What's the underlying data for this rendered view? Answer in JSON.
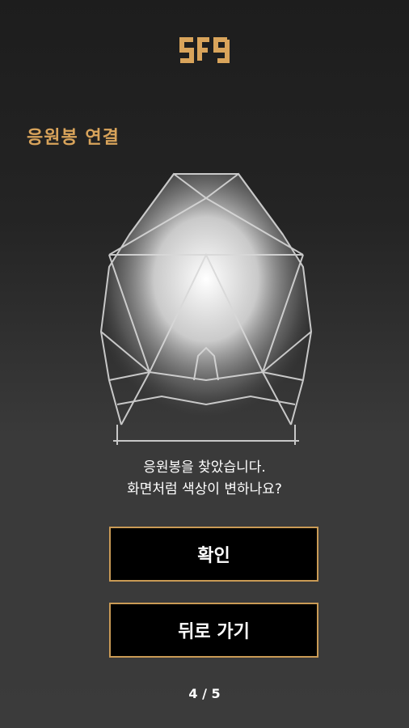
{
  "logo_text": "SF9",
  "colors": {
    "accent": "#d9a45b",
    "button_border": "#c99a55",
    "panel": "#3a3a3a"
  },
  "header": {
    "title": "응원봉 연결"
  },
  "message": {
    "line1": "응원봉을 찾았습니다.",
    "line2": "화면처럼 색상이 변하나요?"
  },
  "buttons": {
    "confirm": "확인",
    "back": "뒤로 가기"
  },
  "pager": "4 / 5"
}
